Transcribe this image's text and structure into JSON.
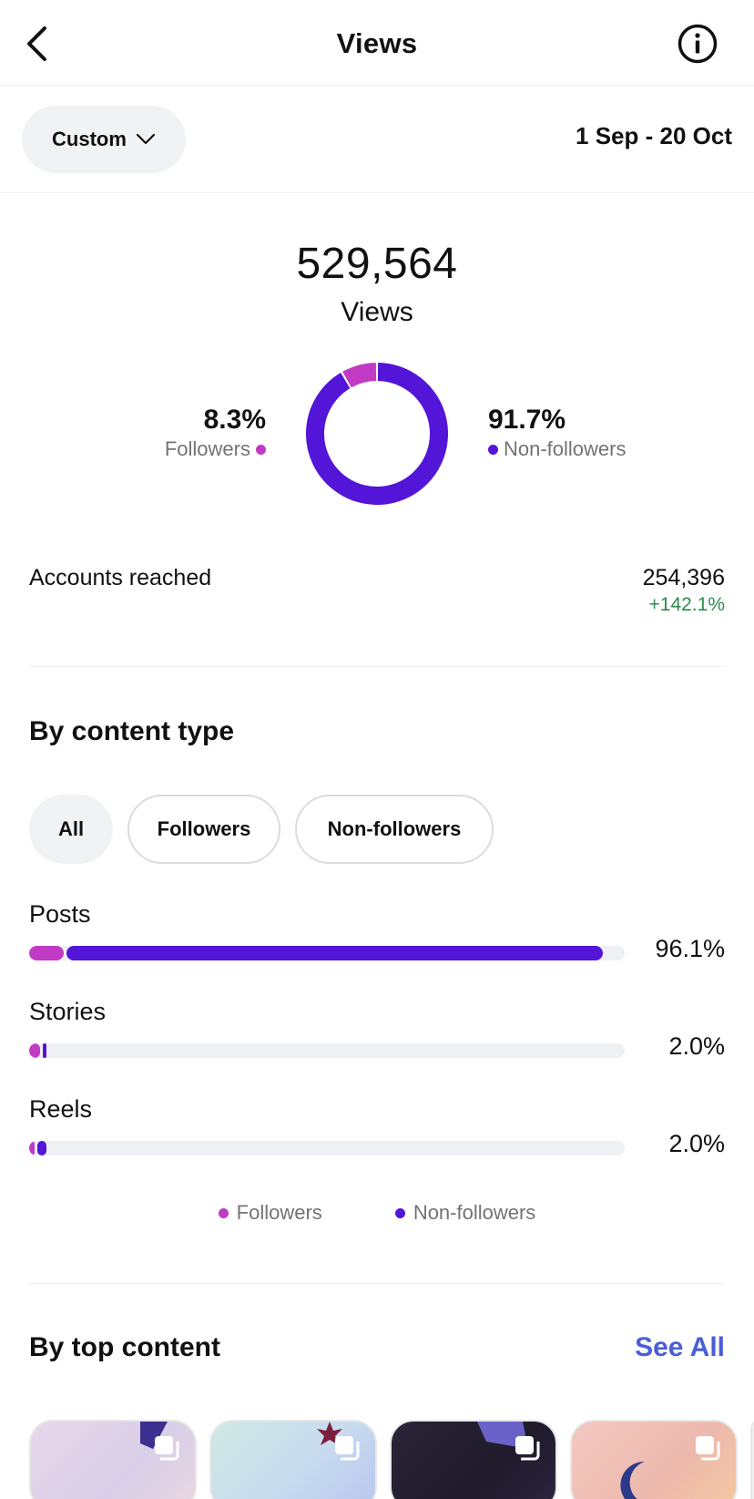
{
  "header": {
    "title": "Views"
  },
  "filter": {
    "period_label": "Custom",
    "date_range": "1 Sep - 20 Oct"
  },
  "overview": {
    "total_value": "529,564",
    "total_label": "Views",
    "followers_pct_text": "8.3%",
    "followers_label": "Followers",
    "non_followers_pct_text": "91.7%",
    "non_followers_label": "Non-followers"
  },
  "accounts_reached": {
    "label": "Accounts reached",
    "value": "254,396",
    "change": "+142.1%"
  },
  "content_type": {
    "title": "By content type",
    "chips": [
      "All",
      "Followers",
      "Non-followers"
    ],
    "active_chip": 0,
    "rows": [
      {
        "label": "Posts",
        "value_text": "96.1%",
        "followers_fraction": 0.058,
        "non_followers_fraction": 0.9
      },
      {
        "label": "Stories",
        "value_text": "2.0%",
        "followers_fraction": 0.018,
        "non_followers_fraction": 0.004
      },
      {
        "label": "Reels",
        "value_text": "2.0%",
        "followers_fraction": 0.008,
        "non_followers_fraction": 0.016
      }
    ],
    "legend": [
      "Followers",
      "Non-followers"
    ]
  },
  "top_content": {
    "title": "By top content",
    "see_all": "See All"
  },
  "colors": {
    "followers": "#c13ac4",
    "non_followers": "#5315d8",
    "positive_change": "#2e8b4e",
    "link": "#4a5ed6"
  },
  "chart_data": {
    "type": "pie",
    "categories": [
      "Followers",
      "Non-followers"
    ],
    "values": [
      8.3,
      91.7
    ]
  }
}
